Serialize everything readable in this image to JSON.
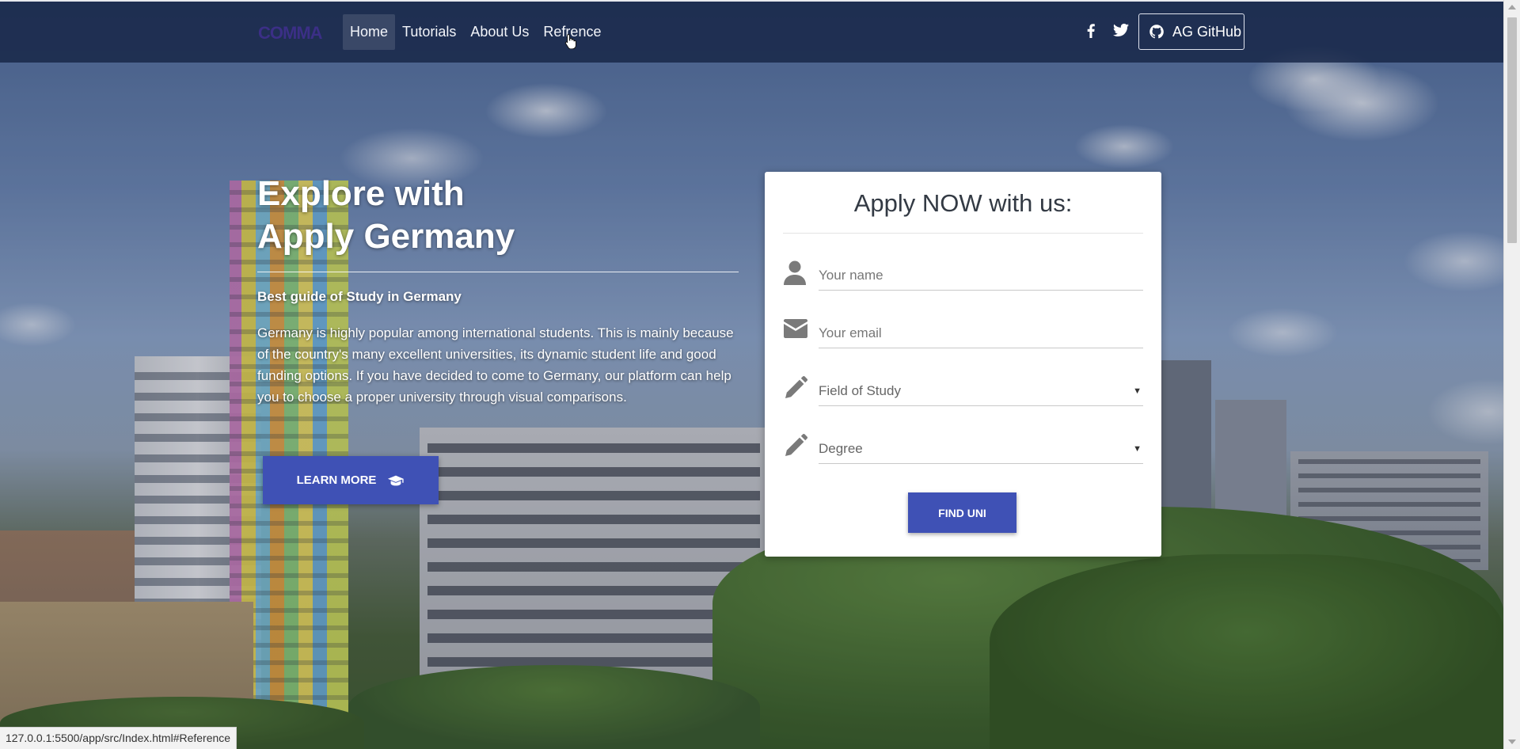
{
  "nav": {
    "logo_text": "COMMA",
    "links": [
      {
        "label": "Home",
        "active": true
      },
      {
        "label": "Tutorials",
        "active": false
      },
      {
        "label": "About Us",
        "active": false
      },
      {
        "label": "Refrence",
        "active": false
      }
    ],
    "social": [
      "facebook-icon",
      "twitter-icon"
    ],
    "github_label": "AG GitHub"
  },
  "hero": {
    "title_line1": "Explore with",
    "title_line2": "Apply Germany",
    "subtitle": "Best guide of Study in Germany",
    "body": "Germany is highly popular among international students. This is mainly because of the country's many excellent universities, its dynamic student life and good funding options. If you have decided to come to Germany, our platform can help you to choose a proper university through visual comparisons.",
    "learn_more_label": "LEARN MORE"
  },
  "form": {
    "title": "Apply NOW with us:",
    "name_placeholder": "Your name",
    "email_placeholder": "Your email",
    "field_of_study": "Field of Study",
    "degree": "Degree",
    "submit_label": "FIND UNI"
  },
  "status_bar": {
    "url": "127.0.0.1:5500/app/src/Index.html#Reference"
  },
  "colors": {
    "accent": "#3f51b5",
    "navbar": "#162446",
    "logo": "#3b2f86"
  }
}
